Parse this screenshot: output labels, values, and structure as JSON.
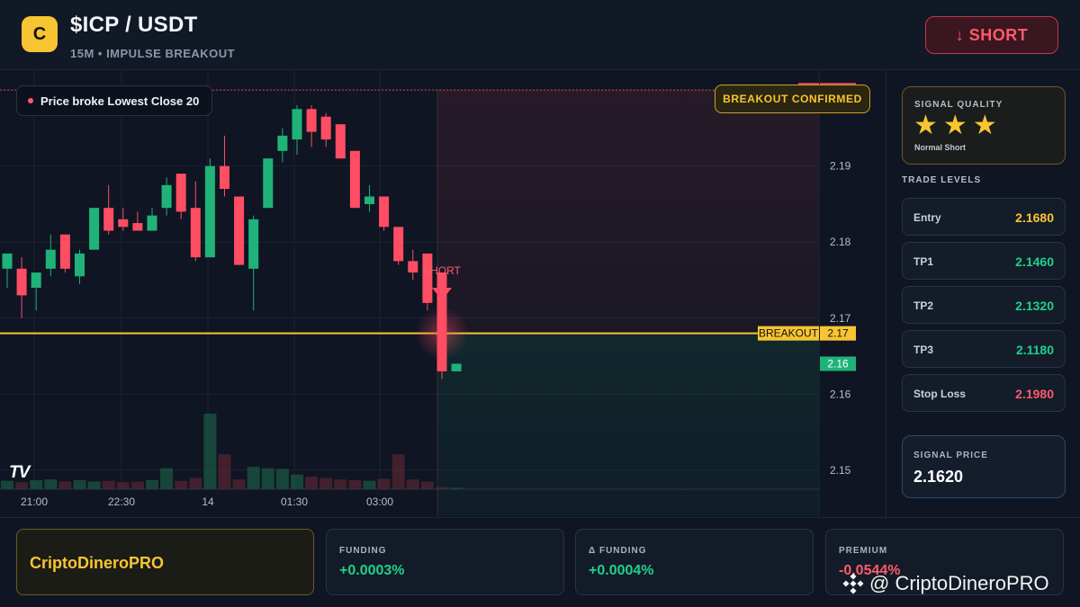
{
  "header": {
    "logo_letter": "C",
    "pair": "$ICP / USDT",
    "subtitle": "15M • IMPULSE BREAKOUT",
    "short_label": "↓ SHORT"
  },
  "chart": {
    "legend_text": "Price broke Lowest Close 20",
    "badge": "BREAKOUT CONFIRMED",
    "tv_logo": "TV",
    "short_marker_label": "SHORT",
    "sl_tag": "SL",
    "sl_value": "2.20",
    "breakout_tag": "BREAKOUT",
    "breakout_value": "2.17",
    "last_price": "2.16",
    "price_ticks": [
      "2.20",
      "2.19",
      "2.18",
      "2.17",
      "2.16",
      "2.15"
    ],
    "time_ticks": [
      "21:00",
      "22:30",
      "14",
      "01:30",
      "03:00"
    ]
  },
  "chart_data": {
    "type": "candlestick",
    "x_ticks": [
      "21:00",
      "22:30",
      "14",
      "01:30",
      "03:00"
    ],
    "y_ticks": [
      2.15,
      2.16,
      2.17,
      2.18,
      2.19,
      2.2
    ],
    "ylim": [
      2.1475,
      2.2025
    ],
    "levels": {
      "stop_loss": 2.2,
      "breakout": 2.168
    },
    "candles": [
      {
        "o": 2.1765,
        "h": 2.1785,
        "l": 2.174,
        "c": 2.1785
      },
      {
        "o": 2.1765,
        "h": 2.178,
        "l": 2.17,
        "c": 2.173
      },
      {
        "o": 2.174,
        "h": 2.175,
        "l": 2.171,
        "c": 2.176
      },
      {
        "o": 2.1765,
        "h": 2.181,
        "l": 2.1755,
        "c": 2.179
      },
      {
        "o": 2.181,
        "h": 2.181,
        "l": 2.176,
        "c": 2.1765
      },
      {
        "o": 2.1755,
        "h": 2.179,
        "l": 2.1745,
        "c": 2.1785
      },
      {
        "o": 2.179,
        "h": 2.1845,
        "l": 2.179,
        "c": 2.1845
      },
      {
        "o": 2.1845,
        "h": 2.1875,
        "l": 2.181,
        "c": 2.1815
      },
      {
        "o": 2.183,
        "h": 2.1845,
        "l": 2.1815,
        "c": 2.182
      },
      {
        "o": 2.1825,
        "h": 2.184,
        "l": 2.1815,
        "c": 2.1815
      },
      {
        "o": 2.1815,
        "h": 2.1845,
        "l": 2.1815,
        "c": 2.1835
      },
      {
        "o": 2.1845,
        "h": 2.1885,
        "l": 2.1835,
        "c": 2.1875
      },
      {
        "o": 2.189,
        "h": 2.189,
        "l": 2.183,
        "c": 2.184
      },
      {
        "o": 2.1845,
        "h": 2.188,
        "l": 2.1775,
        "c": 2.178
      },
      {
        "o": 2.178,
        "h": 2.191,
        "l": 2.178,
        "c": 2.19
      },
      {
        "o": 2.19,
        "h": 2.194,
        "l": 2.186,
        "c": 2.187
      },
      {
        "o": 2.186,
        "h": 2.186,
        "l": 2.177,
        "c": 2.177
      },
      {
        "o": 2.1765,
        "h": 2.1835,
        "l": 2.171,
        "c": 2.183
      },
      {
        "o": 2.1845,
        "h": 2.191,
        "l": 2.1845,
        "c": 2.191
      },
      {
        "o": 2.192,
        "h": 2.195,
        "l": 2.1905,
        "c": 2.194
      },
      {
        "o": 2.1935,
        "h": 2.198,
        "l": 2.1915,
        "c": 2.1975
      },
      {
        "o": 2.1975,
        "h": 2.198,
        "l": 2.1925,
        "c": 2.1945
      },
      {
        "o": 2.1965,
        "h": 2.197,
        "l": 2.1925,
        "c": 2.1935
      },
      {
        "o": 2.1955,
        "h": 2.1955,
        "l": 2.191,
        "c": 2.191
      },
      {
        "o": 2.192,
        "h": 2.192,
        "l": 2.1845,
        "c": 2.1845
      },
      {
        "o": 2.185,
        "h": 2.1875,
        "l": 2.184,
        "c": 2.186
      },
      {
        "o": 2.186,
        "h": 2.186,
        "l": 2.1815,
        "c": 2.182
      },
      {
        "o": 2.182,
        "h": 2.182,
        "l": 2.177,
        "c": 2.1775
      },
      {
        "o": 2.1775,
        "h": 2.179,
        "l": 2.175,
        "c": 2.176
      },
      {
        "o": 2.1785,
        "h": 2.1785,
        "l": 2.171,
        "c": 2.172
      },
      {
        "o": 2.176,
        "h": 2.176,
        "l": 2.162,
        "c": 2.163
      },
      {
        "o": 2.163,
        "h": 2.164,
        "l": 2.163,
        "c": 2.164
      }
    ],
    "volume": [
      1.2,
      1.0,
      1.3,
      1.4,
      1.1,
      1.3,
      1.1,
      1.2,
      1.0,
      1.1,
      1.3,
      3.0,
      1.2,
      1.6,
      10.8,
      5.0,
      1.4,
      3.2,
      3.0,
      2.9,
      2.1,
      1.8,
      1.6,
      1.4,
      1.3,
      1.2,
      1.5,
      5.0,
      1.4,
      1.1,
      0.3,
      0.2
    ]
  },
  "signal_quality": {
    "title": "SIGNAL QUALITY",
    "stars": 3,
    "level": "Normal Short"
  },
  "trade_levels": {
    "title": "TRADE LEVELS",
    "rows": [
      {
        "label": "Entry",
        "value": "2.1680",
        "color": "#f7c531"
      },
      {
        "label": "TP1",
        "value": "2.1460",
        "color": "#1fd18a"
      },
      {
        "label": "TP2",
        "value": "2.1320",
        "color": "#1fd18a"
      },
      {
        "label": "TP3",
        "value": "2.1180",
        "color": "#1fd18a"
      },
      {
        "label": "Stop Loss",
        "value": "2.1980",
        "color": "#ff5a6c"
      }
    ]
  },
  "signal_price": {
    "label": "SIGNAL PRICE",
    "value": "2.1620"
  },
  "footer": {
    "brand": "CriptoDineroPRO",
    "stats": [
      {
        "label": "FUNDING",
        "value": "+0.0003%",
        "color": "#1fd18a"
      },
      {
        "label": "Δ FUNDING",
        "value": "+0.0004%",
        "color": "#1fd18a"
      },
      {
        "label": "PREMIUM",
        "value": "-0.0544%",
        "color": "#ff5a6c"
      }
    ],
    "watermark": "@ CriptoDineroPRO"
  },
  "colors": {
    "up": "#1fb37a",
    "down": "#ff4d63",
    "accent": "#f7c531"
  }
}
